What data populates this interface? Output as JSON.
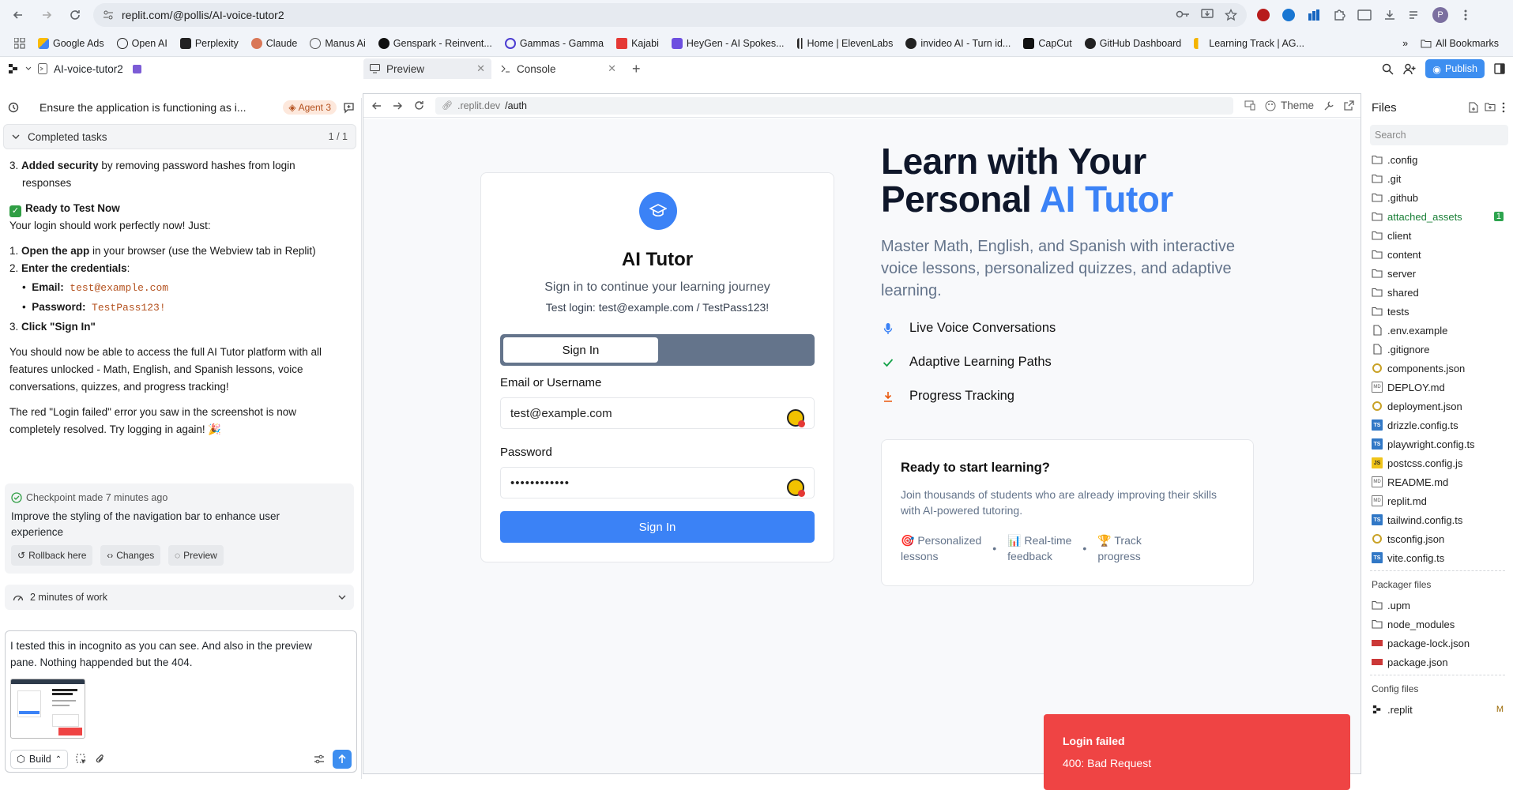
{
  "browser": {
    "url": "replit.com/@pollis/AI-voice-tutor2",
    "bookmarks": [
      "Google Ads",
      "Open AI",
      "Perplexity",
      "Claude",
      "Manus Ai",
      "Genspark - Reinvent...",
      "Gammas - Gamma",
      "Kajabi",
      "HeyGen - AI Spokes...",
      "Home | ElevenLabs",
      "invideo AI - Turn id...",
      "CapCut",
      "GitHub Dashboard",
      "Learning Track | AG..."
    ],
    "all_bookmarks": "All Bookmarks",
    "overflow": "»",
    "profile_initial": "P"
  },
  "workspace": {
    "project_name": "AI-voice-tutor2",
    "tabs": [
      {
        "label": "Preview"
      },
      {
        "label": "Console"
      }
    ],
    "publish_label": "Publish"
  },
  "agent": {
    "title": "Ensure the application is functioning as i...",
    "badge": "Agent 3",
    "completed_label": "Completed tasks",
    "completed_count": "1 / 1",
    "msg": {
      "item3_num": "3.",
      "item3_bold": "Added security",
      "item3_rest": " by removing password hashes from login",
      "item3_rest2": "responses",
      "ready_heading": "Ready to Test Now",
      "ready_intro": "Your login should work perfectly now! Just:",
      "s1_num": "1.",
      "s1_bold": "Open the app",
      "s1_rest": " in your browser (use the Webview tab in Replit)",
      "s2_num": "2.",
      "s2_bold": "Enter the credentials",
      "s2_colon": ":",
      "email_label": "Email:",
      "email_value": "test@example.com",
      "password_label": "Password:",
      "password_value": "TestPass123!",
      "s3_num": "3.",
      "s3_bold": "Click \"Sign In\"",
      "para1_l1": "You should now be able to access the full AI Tutor platform with all",
      "para1_l2": "features unlocked - Math, English, and Spanish lessons, voice",
      "para1_l3": "conversations, quizzes, and progress tracking!",
      "para2_l1": "The red \"Login failed\" error you saw in the screenshot is now",
      "para2_l2": "completely resolved. Try logging in again! 🎉"
    },
    "checkpoint": {
      "meta": "Checkpoint made 7 minutes ago",
      "desc_l1": "Improve the styling of the navigation bar to enhance user",
      "desc_l2": "experience",
      "rollback": "Rollback here",
      "changes": "Changes",
      "preview": "Preview"
    },
    "work": "2 minutes of work",
    "input_l1": "I tested this in incognito as you can see.  And also in the preview",
    "input_l2": "pane.  Nothing happended but the 404.",
    "build_label": "Build"
  },
  "preview": {
    "url_host": ".replit.dev",
    "url_path": "/auth",
    "theme_label": "Theme"
  },
  "site": {
    "brand": "AI Tutor",
    "subtitle": "Sign in to continue your learning journey",
    "test_login": "Test login: test@example.com / TestPass123!",
    "toggle_active": "Sign In",
    "email_label": "Email or Username",
    "email_value": "test@example.com",
    "password_label": "Password",
    "password_mask": "••••••••••••",
    "submit": "Sign In",
    "hero_l1": "Learn with Your",
    "hero_l2a": "Personal ",
    "hero_l2b": "AI Tutor",
    "hero_sub": "Master Math, English, and Spanish with interactive voice lessons, personalized quizzes, and adaptive learning.",
    "features": [
      "Live Voice Conversations",
      "Adaptive Learning Paths",
      "Progress Tracking"
    ],
    "ready_title": "Ready to start learning?",
    "ready_sub": "Join thousands of students who are already improving their skills with AI-powered tutoring.",
    "tags": [
      {
        "emoji": "🎯",
        "l1": "Personalized",
        "l2": "lessons"
      },
      {
        "emoji": "📊",
        "l1": "Real-time",
        "l2": "feedback"
      },
      {
        "emoji": "🏆",
        "l1": "Track",
        "l2": "progress"
      }
    ],
    "toast_title": "Login failed",
    "toast_msg": "400: Bad Request"
  },
  "files": {
    "header": "Files",
    "search_placeholder": "Search",
    "items": [
      {
        "name": ".config",
        "type": "folder"
      },
      {
        "name": ".git",
        "type": "folder"
      },
      {
        "name": ".github",
        "type": "folder"
      },
      {
        "name": "attached_assets",
        "type": "folder",
        "mark": "1"
      },
      {
        "name": "client",
        "type": "folder"
      },
      {
        "name": "content",
        "type": "folder"
      },
      {
        "name": "server",
        "type": "folder"
      },
      {
        "name": "shared",
        "type": "folder"
      },
      {
        "name": "tests",
        "type": "folder"
      },
      {
        "name": ".env.example",
        "type": "file"
      },
      {
        "name": ".gitignore",
        "type": "file"
      },
      {
        "name": "components.json",
        "type": "json"
      },
      {
        "name": "DEPLOY.md",
        "type": "md"
      },
      {
        "name": "deployment.json",
        "type": "json"
      },
      {
        "name": "drizzle.config.ts",
        "type": "ts"
      },
      {
        "name": "playwright.config.ts",
        "type": "ts"
      },
      {
        "name": "postcss.config.js",
        "type": "js"
      },
      {
        "name": "README.md",
        "type": "md"
      },
      {
        "name": "replit.md",
        "type": "md"
      },
      {
        "name": "tailwind.config.ts",
        "type": "ts"
      },
      {
        "name": "tsconfig.json",
        "type": "json"
      },
      {
        "name": "vite.config.ts",
        "type": "ts"
      }
    ],
    "packager_label": "Packager files",
    "packager_items": [
      {
        "name": ".upm",
        "type": "folder"
      },
      {
        "name": "node_modules",
        "type": "folder"
      },
      {
        "name": "package-lock.json",
        "type": "npm"
      },
      {
        "name": "package.json",
        "type": "npm"
      }
    ],
    "config_label": "Config files",
    "config_items": [
      {
        "name": ".replit",
        "type": "replit",
        "mark": "M"
      }
    ]
  },
  "colors": {
    "accent": "#3b82f6",
    "error": "#ef4444",
    "publish": "#3d8ef0"
  }
}
